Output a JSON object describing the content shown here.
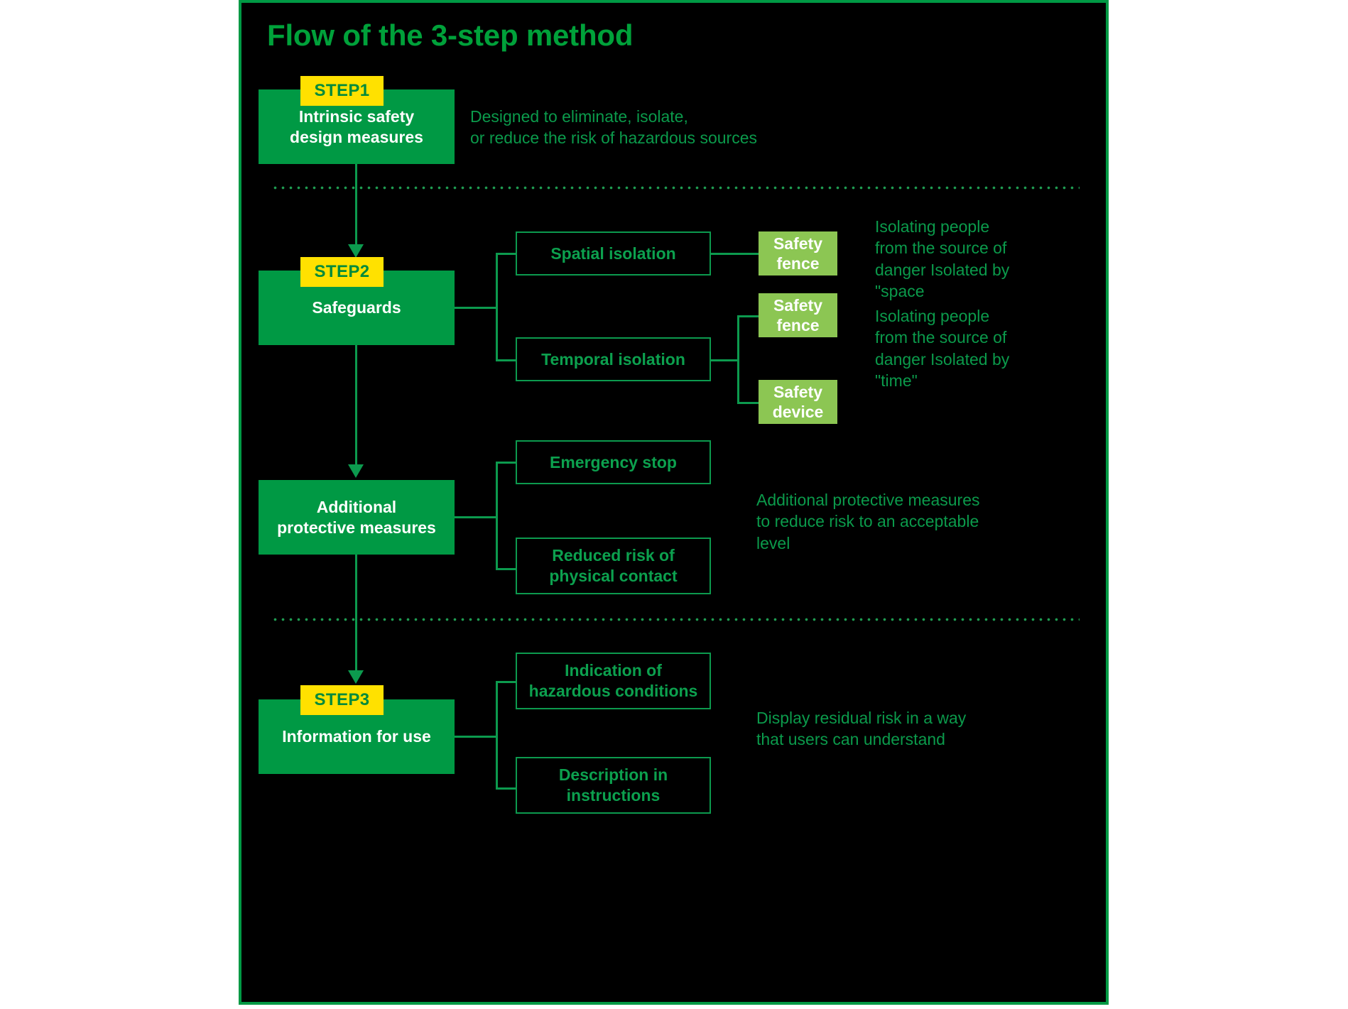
{
  "title": "Flow of the 3-step method",
  "steps": [
    {
      "chip": "STEP1",
      "label": "Intrinsic safety\ndesign measures",
      "note": "Designed to eliminate, isolate,\nor reduce the risk of hazardous sources",
      "branches": []
    },
    {
      "chip": "STEP2",
      "label": "Safeguards",
      "branches": [
        {
          "label": "Spatial isolation",
          "leaves": [
            "Safety\nfence"
          ],
          "note": "Isolating people\nfrom the source of\ndanger Isolated by\n\"space"
        },
        {
          "label": "Temporal isolation",
          "leaves": [
            "Safety\nfence",
            "Safety\ndevice"
          ],
          "note": "Isolating people\nfrom the source of\ndanger Isolated by\n\"time\""
        }
      ]
    },
    {
      "chip": "",
      "label": "Additional\nprotective measures",
      "note": "Additional protective measures\nto reduce risk to an acceptable\nlevel",
      "branches": [
        {
          "label": "Emergency stop",
          "leaves": [],
          "note": ""
        },
        {
          "label": "Reduced risk of\nphysical contact",
          "leaves": [],
          "note": ""
        }
      ]
    },
    {
      "chip": "STEP3",
      "label": "Information for use",
      "note": "Display residual risk in a way\nthat users can understand",
      "branches": [
        {
          "label": "Indication of\nhazardous conditions",
          "leaves": [],
          "note": ""
        },
        {
          "label": "Description in\ninstructions",
          "leaves": [],
          "note": ""
        }
      ]
    }
  ],
  "colors": {
    "frame_border": "#009944",
    "background": "#000000",
    "step_box": "#009944",
    "chip_bg": "#ffe100",
    "chip_text": "#008a3c",
    "leaf_box": "#8cc653",
    "accent_text": "#0ca04e",
    "title_text": "#00a13a"
  }
}
